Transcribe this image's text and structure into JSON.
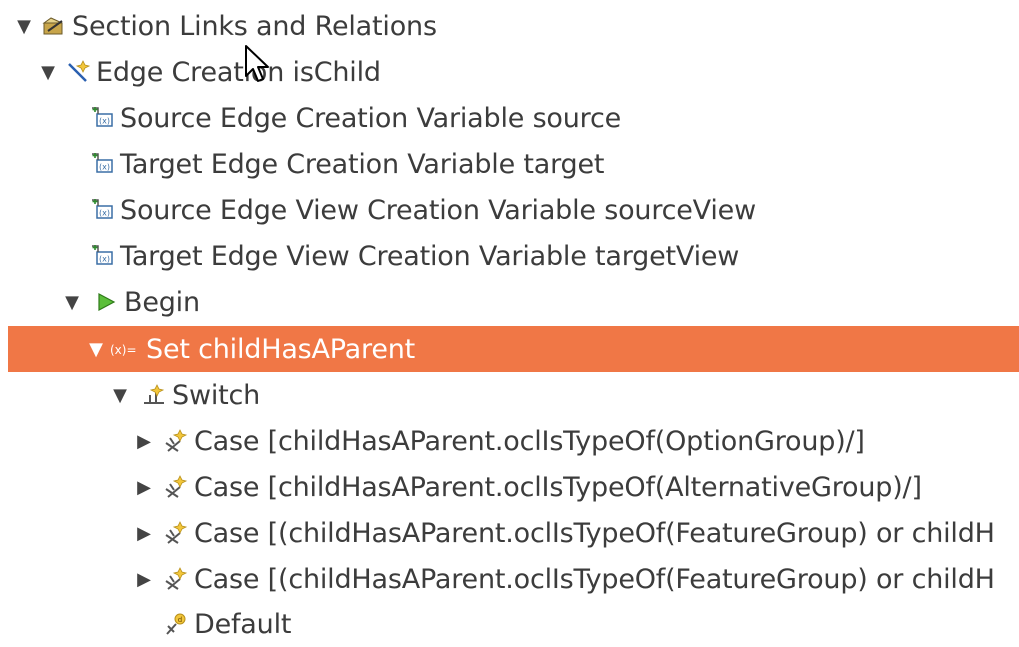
{
  "tree": {
    "rows": [
      {
        "label": "Section Links and Relations",
        "expand": "expanded",
        "icon": "section-icon"
      },
      {
        "label": "Edge Creation isChild",
        "expand": "expanded",
        "icon": "edge-creation-icon"
      },
      {
        "label": "Source Edge Creation Variable source",
        "expand": "none",
        "icon": "variable-icon"
      },
      {
        "label": "Target Edge Creation Variable target",
        "expand": "none",
        "icon": "variable-icon"
      },
      {
        "label": "Source Edge View Creation Variable sourceView",
        "expand": "none",
        "icon": "variable-icon"
      },
      {
        "label": "Target Edge View Creation Variable targetView",
        "expand": "none",
        "icon": "variable-icon"
      },
      {
        "label": "Begin",
        "expand": "expanded",
        "icon": "begin-icon"
      },
      {
        "label": "Set childHasAParent",
        "expand": "expanded",
        "icon": "set-value-icon",
        "selected": true
      },
      {
        "label": "Switch",
        "expand": "expanded",
        "icon": "switch-icon"
      },
      {
        "label": "Case [childHasAParent.oclIsTypeOf(OptionGroup)/]",
        "expand": "collapsed",
        "icon": "case-icon"
      },
      {
        "label": "Case [childHasAParent.oclIsTypeOf(AlternativeGroup)/]",
        "expand": "collapsed",
        "icon": "case-icon"
      },
      {
        "label": "Case [(childHasAParent.oclIsTypeOf(FeatureGroup) or childH",
        "expand": "collapsed",
        "icon": "case-icon"
      },
      {
        "label": "Case [(childHasAParent.oclIsTypeOf(FeatureGroup) or childH",
        "expand": "collapsed",
        "icon": "case-icon"
      },
      {
        "label": "Default",
        "expand": "none",
        "icon": "default-icon"
      }
    ],
    "selection_color": "#f07746"
  }
}
